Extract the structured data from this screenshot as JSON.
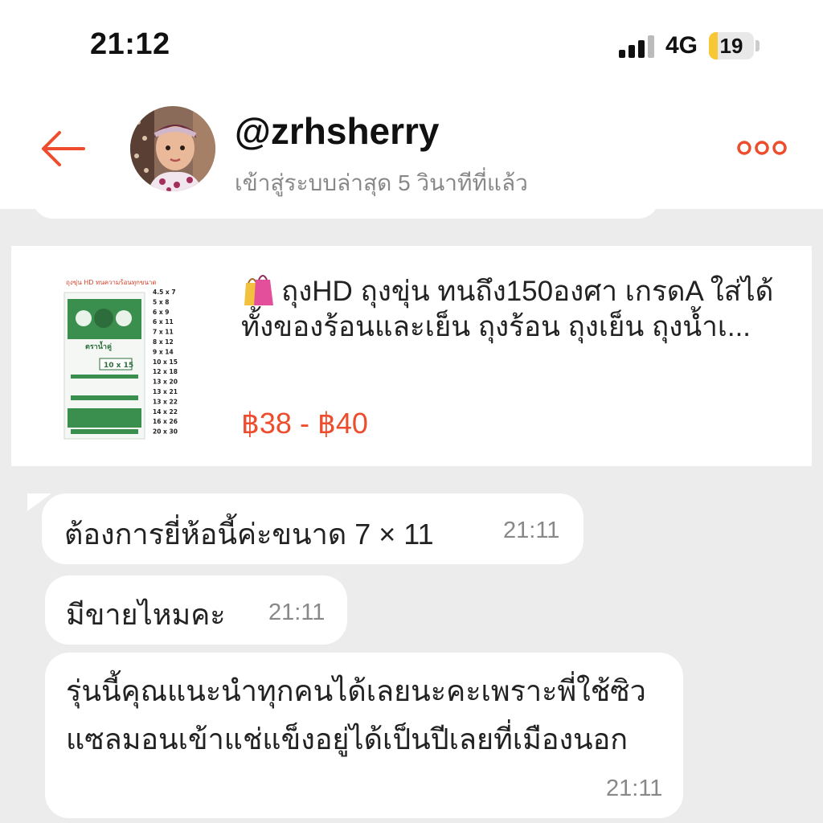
{
  "status_bar": {
    "time": "21:12",
    "network": "4G",
    "battery": "19",
    "battery_level": 0.19
  },
  "header": {
    "back_icon": "arrow-left-icon",
    "username": "@zrhsherry",
    "last_seen": "เข้าสู่ระบบล่าสุด 5 วินาทีที่แล้ว",
    "more_icon": "more-dots-icon",
    "accent_color": "#ee4d2d"
  },
  "product": {
    "title": "ถุงHD ถุงขุ่น ทนถึง150องศา เกรดA ใส่ได้ทั้งของร้อนและเย็น ถุงร้อน ถุงเย็น ถุงน้ำเ...",
    "price": "฿38 - ฿40",
    "image_header": "ถุงขุ่น HD ทนความร้อนทุกขนาด",
    "image_brand": "ตราน้ำคู่",
    "image_size": "10 x 15",
    "image_sizes": [
      "4.5 x 7",
      "5 x 8",
      "6 x 9",
      "6 x 11",
      "7 x 11",
      "8 x 12",
      "9 x 14",
      "10 x 15",
      "12 x 18",
      "13 x 20",
      "13 x 21",
      "13 x 22",
      "14 x 22",
      "16 x 26",
      "20 x 30"
    ]
  },
  "messages": [
    {
      "text": "ต้องการยี่ห้อนี้ค่ะขนาด 7 × 11",
      "time": "21:11"
    },
    {
      "text": "มีขายไหมคะ",
      "time": "21:11"
    },
    {
      "text": "รุ่นนี้คุณแนะนำทุกคนได้เลยนะคะเพราะพี่ใช้ซิวแซลมอนเข้าแช่แข็งอยู่ได้เป็นปีเลยที่เมืองนอก",
      "time": "21:11"
    }
  ]
}
